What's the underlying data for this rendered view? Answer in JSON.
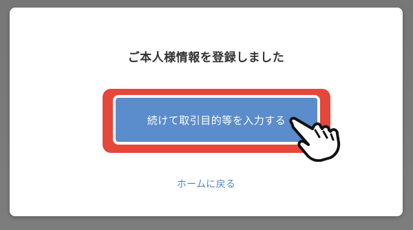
{
  "modal": {
    "title": "ご本人様情報を登録しました",
    "primary_button_label": "続けて取引目的等を入力する",
    "home_link_label": "ホームに戻る"
  },
  "colors": {
    "primary_button": "#5b8ccc",
    "highlight_frame": "#e5473a",
    "link": "#4f86c6",
    "backdrop": "#7a7a7a"
  },
  "icons": {
    "cursor": "pointing-hand-cursor-icon"
  }
}
